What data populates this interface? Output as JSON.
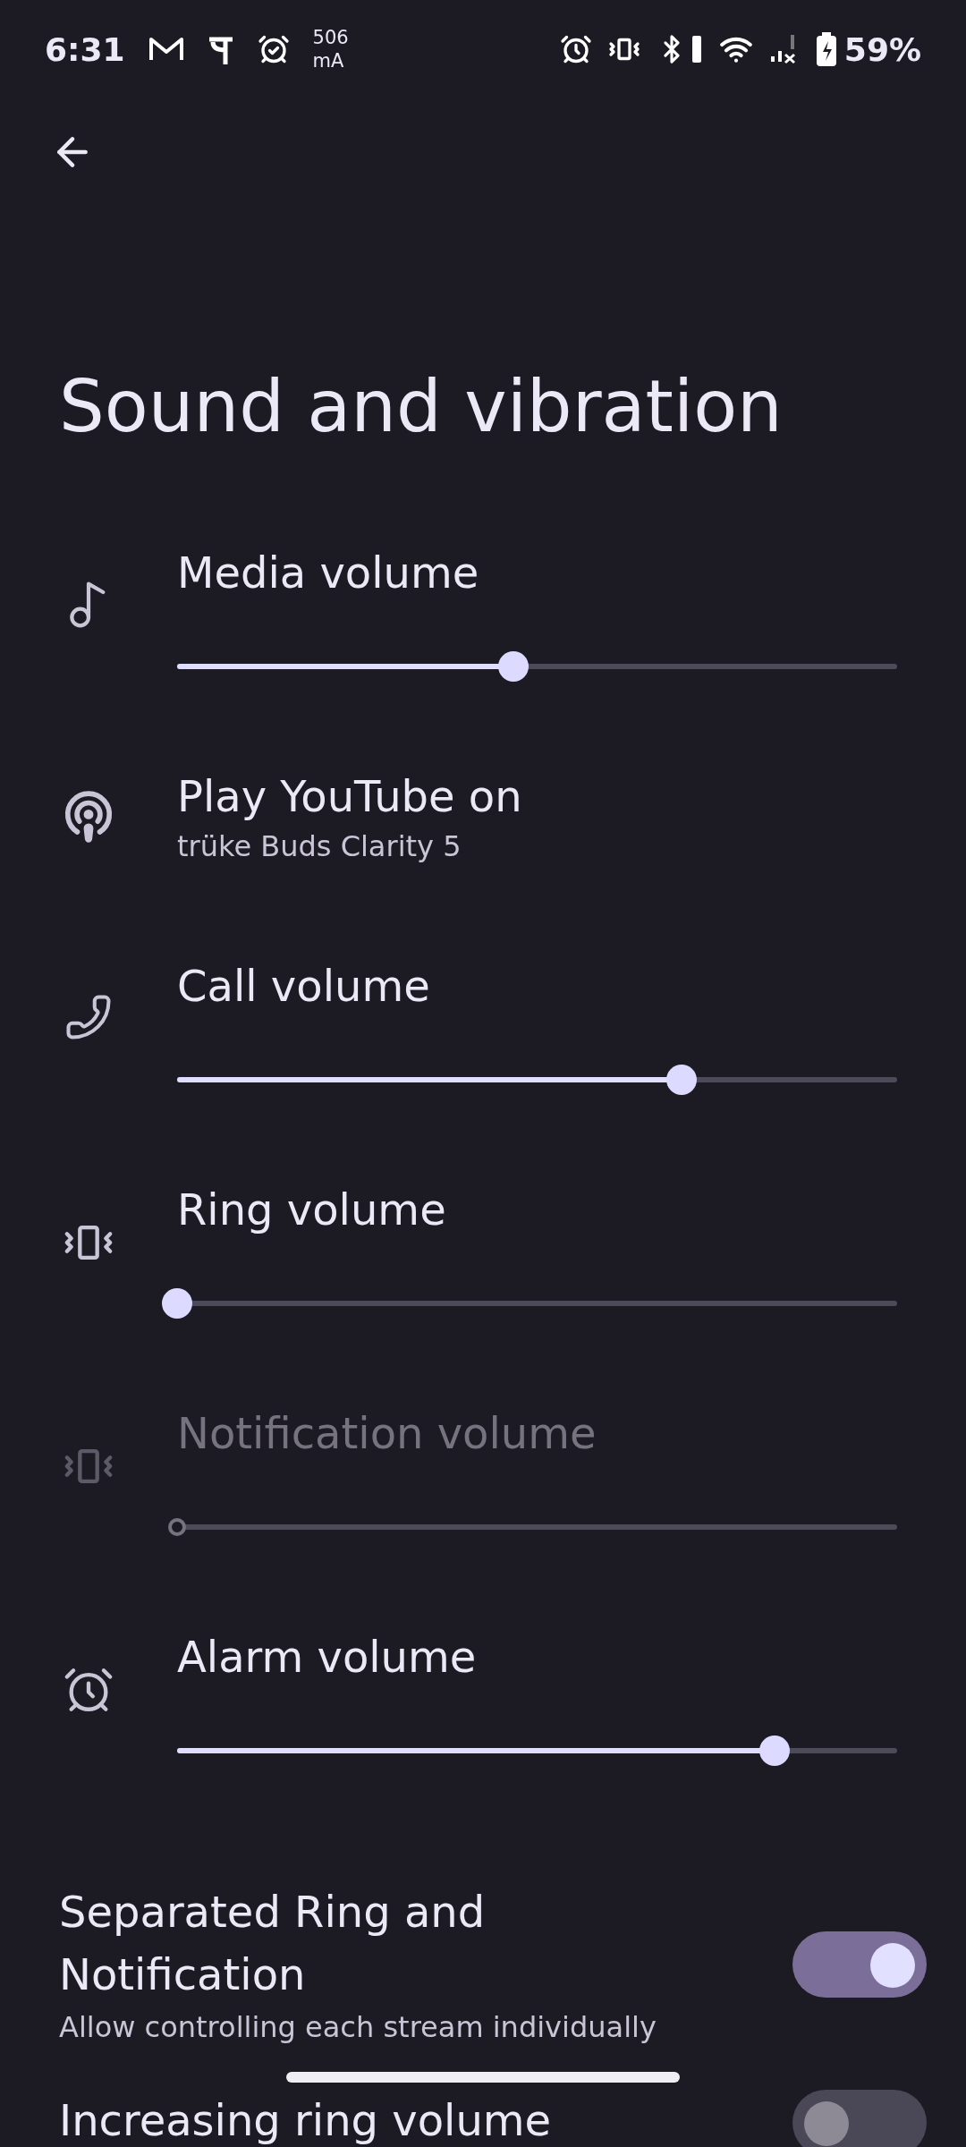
{
  "status_bar": {
    "time": "6:31",
    "current_value": "506",
    "current_unit": "mA",
    "battery": "59%"
  },
  "title": "Sound and vibration",
  "items": [
    {
      "kind": "slider",
      "label": "Media volume",
      "level": 0.467,
      "disabled": false
    },
    {
      "kind": "output",
      "label": "Play YouTube on",
      "subtitle": "trüke Buds Clarity 5"
    },
    {
      "kind": "slider",
      "label": "Call volume",
      "level": 0.7,
      "disabled": false
    },
    {
      "kind": "slider",
      "label": "Ring volume",
      "level": 0,
      "disabled": false
    },
    {
      "kind": "slider",
      "label": "Notification volume",
      "level": 0,
      "disabled": true
    },
    {
      "kind": "slider",
      "label": "Alarm volume",
      "level": 0.83,
      "disabled": false
    }
  ],
  "toggles": [
    {
      "title": "Separated Ring and Notification",
      "subtitle": "Allow controlling each stream individually",
      "on": true
    },
    {
      "title": "Increasing ring volume",
      "on": false
    }
  ]
}
